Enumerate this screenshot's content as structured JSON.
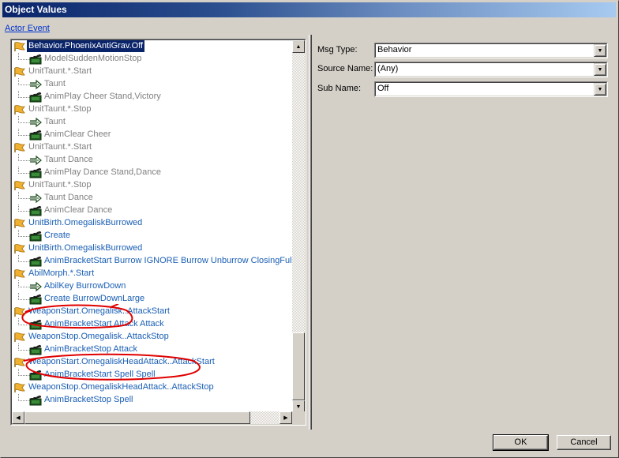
{
  "window": {
    "title": "Object Values"
  },
  "header": {
    "link": "Actor Event"
  },
  "tree": {
    "rows": [
      {
        "level": 0,
        "icon": "flag-icon",
        "text": "Behavior.PhoenixAntiGrav.Off",
        "style": "selected"
      },
      {
        "level": 1,
        "icon": "clapperboard-icon",
        "text": "ModelSuddenMotionStop",
        "style": "gray"
      },
      {
        "level": 0,
        "icon": "flag-icon",
        "text": "UnitTaunt.*.Start",
        "style": "gray"
      },
      {
        "level": 1,
        "icon": "arrow-icon",
        "text": "Taunt",
        "style": "gray"
      },
      {
        "level": 1,
        "icon": "clapperboard-icon",
        "text": "AnimPlay Cheer Stand,Victory",
        "style": "gray"
      },
      {
        "level": 0,
        "icon": "flag-icon",
        "text": "UnitTaunt.*.Stop",
        "style": "gray"
      },
      {
        "level": 1,
        "icon": "arrow-icon",
        "text": "Taunt",
        "style": "gray"
      },
      {
        "level": 1,
        "icon": "clapperboard-icon",
        "text": "AnimClear Cheer",
        "style": "gray"
      },
      {
        "level": 0,
        "icon": "flag-icon",
        "text": "UnitTaunt.*.Start",
        "style": "gray"
      },
      {
        "level": 1,
        "icon": "arrow-icon",
        "text": "Taunt Dance",
        "style": "gray"
      },
      {
        "level": 1,
        "icon": "clapperboard-icon",
        "text": "AnimPlay Dance Stand,Dance",
        "style": "gray"
      },
      {
        "level": 0,
        "icon": "flag-icon",
        "text": "UnitTaunt.*.Stop",
        "style": "gray"
      },
      {
        "level": 1,
        "icon": "arrow-icon",
        "text": "Taunt Dance",
        "style": "gray"
      },
      {
        "level": 1,
        "icon": "clapperboard-icon",
        "text": "AnimClear Dance",
        "style": "gray"
      },
      {
        "level": 0,
        "icon": "flag-icon",
        "text": "UnitBirth.OmegaliskBurrowed",
        "style": "blue"
      },
      {
        "level": 1,
        "icon": "clapperboard-icon",
        "text": "Create",
        "style": "blue"
      },
      {
        "level": 0,
        "icon": "flag-icon",
        "text": "UnitBirth.OmegaliskBurrowed",
        "style": "blue"
      },
      {
        "level": 1,
        "icon": "clapperboard-icon",
        "text": "AnimBracketStart Burrow IGNORE Burrow Unburrow ClosingFull,In",
        "style": "blue"
      },
      {
        "level": 0,
        "icon": "flag-icon",
        "text": "AbilMorph.*.Start",
        "style": "blue"
      },
      {
        "level": 1,
        "icon": "arrow-icon",
        "text": "AbilKey BurrowDown",
        "style": "blue"
      },
      {
        "level": 1,
        "icon": "clapperboard-icon",
        "text": "Create BurrowDownLarge",
        "style": "blue"
      },
      {
        "level": 0,
        "icon": "flag-icon",
        "text": "WeaponStart.Omegalisk..AttackStart",
        "style": "blue"
      },
      {
        "level": 1,
        "icon": "clapperboard-icon",
        "text": "AnimBracketStart Attack Attack",
        "style": "blue"
      },
      {
        "level": 0,
        "icon": "flag-icon",
        "text": "WeaponStop.Omegalisk..AttackStop",
        "style": "blue"
      },
      {
        "level": 1,
        "icon": "clapperboard-icon",
        "text": "AnimBracketStop Attack",
        "style": "blue"
      },
      {
        "level": 0,
        "icon": "flag-icon",
        "text": "WeaponStart.OmegaliskHeadAttack..AttackStart",
        "style": "blue"
      },
      {
        "level": 1,
        "icon": "clapperboard-icon",
        "text": "AnimBracketStart Spell Spell",
        "style": "blue"
      },
      {
        "level": 0,
        "icon": "flag-icon",
        "text": "WeaponStop.OmegaliskHeadAttack..AttackStop",
        "style": "blue"
      },
      {
        "level": 1,
        "icon": "clapperboard-icon",
        "text": "AnimBracketStop Spell",
        "style": "blue"
      }
    ]
  },
  "form": {
    "msg_type": {
      "label": "Msg Type:",
      "value": "Behavior"
    },
    "source_name": {
      "label": "Source Name:",
      "value": "(Any)"
    },
    "sub_name": {
      "label": "Sub Name:",
      "value": "Off"
    }
  },
  "buttons": {
    "ok": "OK",
    "cancel": "Cancel"
  },
  "colors": {
    "link": "#0033cc",
    "tree_blue": "#1a5fb4",
    "tree_gray": "#808080",
    "selection": "#0a246a",
    "annotation": "#e00000"
  }
}
